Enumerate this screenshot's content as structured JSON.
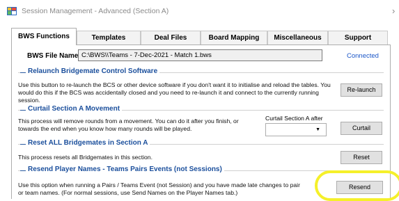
{
  "window": {
    "title": "Session Management - Advanced (Section A)",
    "app_icon": "app-window-icon",
    "chevron_icon": "chevron-right-icon"
  },
  "tabs": [
    {
      "label": "BWS Functions",
      "active": true
    },
    {
      "label": "Templates",
      "active": false
    },
    {
      "label": "Deal Files",
      "active": false
    },
    {
      "label": "Board Mapping",
      "active": false
    },
    {
      "label": "Miscellaneous",
      "active": false
    },
    {
      "label": "Support",
      "active": false
    }
  ],
  "bws": {
    "label": "BWS File Name",
    "value": "C:\\BWS\\\\Teams - 7-Dec-2021 - Match 1.bws",
    "status": "Connected"
  },
  "sections": {
    "relaunch": {
      "title": "Relaunch Bridgemate Control Software",
      "desc_line1": "Use this button to re-launch the BCS or other device software if you don't want it to initialise and reload the tables. You",
      "desc_line2": "would  do this if the BCS was accidentally closed and you need to re-launch it and connect to the currently running session.",
      "button": "Re-launch"
    },
    "curtail": {
      "title": "Curtail Section A Movement",
      "desc_line1": "This process will remove rounds from a movement. You can do it after you finish, or",
      "desc_line2": "towards the end when you know how many rounds will be played.",
      "combo_label": "Curtail Section A after",
      "combo_value": "",
      "button": "Curtail"
    },
    "reset": {
      "title": "Reset ALL Bridgemates in Section A",
      "desc": "This process resets all Bridgemates in this section.",
      "button": "Reset"
    },
    "resend": {
      "title": "Resend Player Names - Teams Pairs Events (not Sessions)",
      "desc_line1": "Use this option when running a Pairs / Teams Event (not Session) and you have made late changes to pair",
      "desc_line2": "or team names. (For normal sessions, use Send Names on the Player Names tab.)",
      "button": "Resend"
    }
  },
  "colors": {
    "section_title": "#1b4f9c",
    "connected": "#1a56c8",
    "highlight": "#f5f02a"
  }
}
